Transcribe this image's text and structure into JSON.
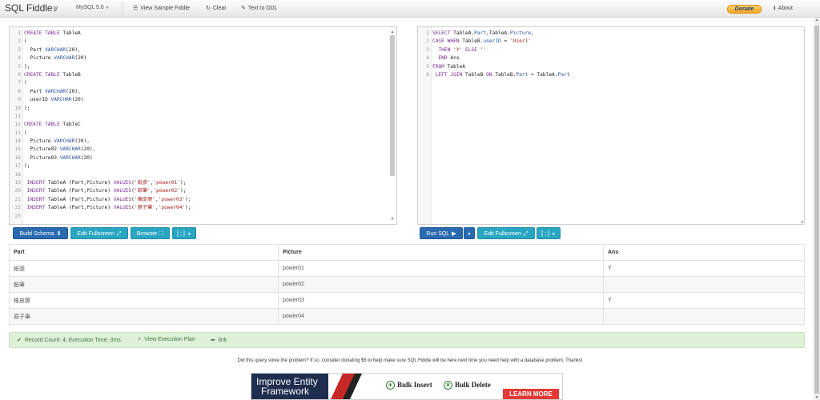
{
  "navbar": {
    "brand": "SQL Fiddle",
    "database": "MySQL 5.6",
    "view_sample": "View Sample Fiddle",
    "clear": "Clear",
    "text_to_ddl": "Text to DDL",
    "donate": "Donate",
    "about": "About"
  },
  "schema_editor": {
    "lines": [
      {
        "n": "1",
        "html": "<span class='kw'>CREATE TABLE</span> TableA"
      },
      {
        "n": "2",
        "html": "("
      },
      {
        "n": "3",
        "html": "  Part <span class='fn'>VARCHAR</span>(20),"
      },
      {
        "n": "4",
        "html": "  Picture <span class='fn'>VARCHAR</span>(20)"
      },
      {
        "n": "5",
        "html": ");"
      },
      {
        "n": "6",
        "html": "<span class='kw'>CREATE TABLE</span> TableB"
      },
      {
        "n": "7",
        "html": "("
      },
      {
        "n": "8",
        "html": "  Part <span class='fn'>VARCHAR</span>(20),"
      },
      {
        "n": "9",
        "html": "  userID <span class='fn'>VARCHAR</span>(20)"
      },
      {
        "n": "10",
        "html": ");"
      },
      {
        "n": "11",
        "html": ""
      },
      {
        "n": "12",
        "html": "<span class='kw'>CREATE TABLE</span> TableC"
      },
      {
        "n": "13",
        "html": "("
      },
      {
        "n": "14",
        "html": "  Picture <span class='fn'>VARCHAR</span>(20),"
      },
      {
        "n": "15",
        "html": "  Picture02 <span class='fn'>VARCHAR</span>(20),"
      },
      {
        "n": "16",
        "html": "  Picture03 <span class='fn'>VARCHAR</span>(20)"
      },
      {
        "n": "17",
        "html": ");"
      },
      {
        "n": "18",
        "html": ""
      },
      {
        "n": "19",
        "html": " <span class='kw'>INSERT</span> TableA (Part,Picture) <span class='kw'>VALUES</span>(<span class='str'>'紙張'</span>,<span class='str'>'power01'</span>);"
      },
      {
        "n": "20",
        "html": " <span class='kw'>INSERT</span> TableA (Part,Picture) <span class='kw'>VALUES</span>(<span class='str'>'鉛筆'</span>,<span class='str'>'power02'</span>);"
      },
      {
        "n": "21",
        "html": " <span class='kw'>INSERT</span> TableA (Part,Picture) <span class='kw'>VALUES</span>(<span class='str'>'橡皮擦'</span>,<span class='str'>'power03'</span>);"
      },
      {
        "n": "22",
        "html": " <span class='kw'>INSERT</span> TableA (Part,Picture) <span class='kw'>VALUES</span>(<span class='str'>'原子筆'</span>,<span class='str'>'power04'</span>);"
      },
      {
        "n": "23",
        "html": ""
      }
    ]
  },
  "query_editor": {
    "lines": [
      {
        "n": "1",
        "html": "<span class='kw'>SELECT</span> TableA.<span class='fn'>Part</span>,TableA.<span class='fn'>Picture</span>,"
      },
      {
        "n": "2",
        "html": "<span class='kw'>CASE WHEN</span> TableB.<span class='fn'>userID</span> = <span class='str'>'User1'</span>"
      },
      {
        "n": "3",
        "html": "  <span class='kw'>THEN</span> <span class='str'>'Y'</span> <span class='kw'>ELSE</span> <span class='str'>''</span>"
      },
      {
        "n": "4",
        "html": "  <span class='kw'>END</span> Ans"
      },
      {
        "n": "5",
        "html": "<span class='kw'>FROM</span> TableA"
      },
      {
        "n": "6",
        "html": " <span class='kw'>LEFT JOIN</span> TableB <span class='kw'>ON</span> TableB.<span class='fn'>Part</span> = TableA.<span class='fn'>Part</span>"
      }
    ]
  },
  "schema_buttons": {
    "build": "Build Schema",
    "edit_fullscreen": "Edit Fullscreen",
    "browser": "Browser",
    "delimiter": "[ ; ]"
  },
  "query_buttons": {
    "run": "Run SQL",
    "edit_fullscreen": "Edit Fullscreen",
    "delimiter": "[ ; ]"
  },
  "results": {
    "columns": [
      "Part",
      "Picture",
      "Ans"
    ],
    "rows": [
      [
        "紙張",
        "power01",
        "Y"
      ],
      [
        "鉛筆",
        "power02",
        ""
      ],
      [
        "橡皮擦",
        "power03",
        "Y"
      ],
      [
        "原子筆",
        "power04",
        ""
      ]
    ]
  },
  "status": {
    "record_count": "Record Count: 4; Execution Time: 3ms",
    "view_plan": "View Execution Plan",
    "link": "link"
  },
  "donate_note": "Did this query solve the problem? If so, consider donating $5 to help make sure SQL Fiddle will be here next time you need help with a database problem. Thanks!",
  "ad": {
    "title_line1": "Improve Entity",
    "title_line2": "Framework",
    "feature1": "Bulk Insert",
    "feature2": "Bulk Delete",
    "cta": "LEARN MORE"
  }
}
